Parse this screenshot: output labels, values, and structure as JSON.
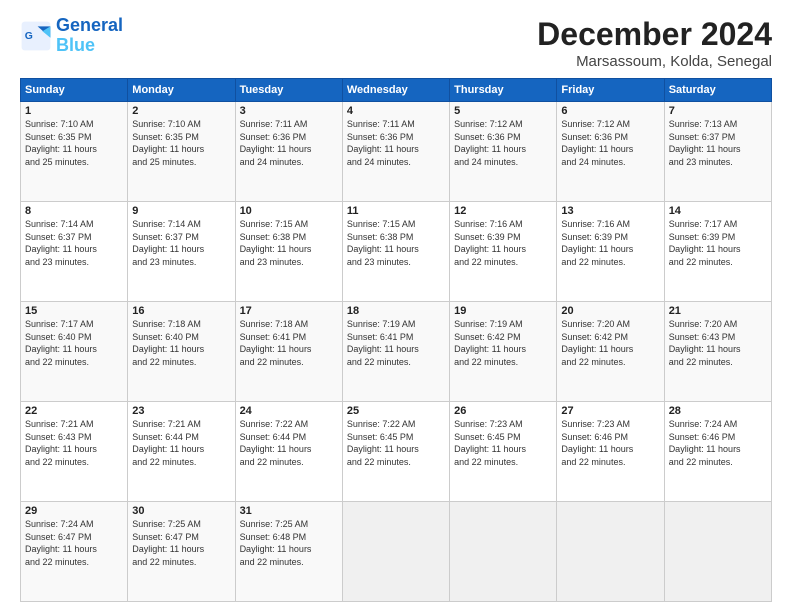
{
  "logo": {
    "line1": "General",
    "line2": "Blue"
  },
  "title": "December 2024",
  "subtitle": "Marsassoum, Kolda, Senegal",
  "days_of_week": [
    "Sunday",
    "Monday",
    "Tuesday",
    "Wednesday",
    "Thursday",
    "Friday",
    "Saturday"
  ],
  "weeks": [
    [
      {
        "day": "1",
        "info": "Sunrise: 7:10 AM\nSunset: 6:35 PM\nDaylight: 11 hours\nand 25 minutes."
      },
      {
        "day": "2",
        "info": "Sunrise: 7:10 AM\nSunset: 6:35 PM\nDaylight: 11 hours\nand 25 minutes."
      },
      {
        "day": "3",
        "info": "Sunrise: 7:11 AM\nSunset: 6:36 PM\nDaylight: 11 hours\nand 24 minutes."
      },
      {
        "day": "4",
        "info": "Sunrise: 7:11 AM\nSunset: 6:36 PM\nDaylight: 11 hours\nand 24 minutes."
      },
      {
        "day": "5",
        "info": "Sunrise: 7:12 AM\nSunset: 6:36 PM\nDaylight: 11 hours\nand 24 minutes."
      },
      {
        "day": "6",
        "info": "Sunrise: 7:12 AM\nSunset: 6:36 PM\nDaylight: 11 hours\nand 24 minutes."
      },
      {
        "day": "7",
        "info": "Sunrise: 7:13 AM\nSunset: 6:37 PM\nDaylight: 11 hours\nand 23 minutes."
      }
    ],
    [
      {
        "day": "8",
        "info": "Sunrise: 7:14 AM\nSunset: 6:37 PM\nDaylight: 11 hours\nand 23 minutes."
      },
      {
        "day": "9",
        "info": "Sunrise: 7:14 AM\nSunset: 6:37 PM\nDaylight: 11 hours\nand 23 minutes."
      },
      {
        "day": "10",
        "info": "Sunrise: 7:15 AM\nSunset: 6:38 PM\nDaylight: 11 hours\nand 23 minutes."
      },
      {
        "day": "11",
        "info": "Sunrise: 7:15 AM\nSunset: 6:38 PM\nDaylight: 11 hours\nand 23 minutes."
      },
      {
        "day": "12",
        "info": "Sunrise: 7:16 AM\nSunset: 6:39 PM\nDaylight: 11 hours\nand 22 minutes."
      },
      {
        "day": "13",
        "info": "Sunrise: 7:16 AM\nSunset: 6:39 PM\nDaylight: 11 hours\nand 22 minutes."
      },
      {
        "day": "14",
        "info": "Sunrise: 7:17 AM\nSunset: 6:39 PM\nDaylight: 11 hours\nand 22 minutes."
      }
    ],
    [
      {
        "day": "15",
        "info": "Sunrise: 7:17 AM\nSunset: 6:40 PM\nDaylight: 11 hours\nand 22 minutes."
      },
      {
        "day": "16",
        "info": "Sunrise: 7:18 AM\nSunset: 6:40 PM\nDaylight: 11 hours\nand 22 minutes."
      },
      {
        "day": "17",
        "info": "Sunrise: 7:18 AM\nSunset: 6:41 PM\nDaylight: 11 hours\nand 22 minutes."
      },
      {
        "day": "18",
        "info": "Sunrise: 7:19 AM\nSunset: 6:41 PM\nDaylight: 11 hours\nand 22 minutes."
      },
      {
        "day": "19",
        "info": "Sunrise: 7:19 AM\nSunset: 6:42 PM\nDaylight: 11 hours\nand 22 minutes."
      },
      {
        "day": "20",
        "info": "Sunrise: 7:20 AM\nSunset: 6:42 PM\nDaylight: 11 hours\nand 22 minutes."
      },
      {
        "day": "21",
        "info": "Sunrise: 7:20 AM\nSunset: 6:43 PM\nDaylight: 11 hours\nand 22 minutes."
      }
    ],
    [
      {
        "day": "22",
        "info": "Sunrise: 7:21 AM\nSunset: 6:43 PM\nDaylight: 11 hours\nand 22 minutes."
      },
      {
        "day": "23",
        "info": "Sunrise: 7:21 AM\nSunset: 6:44 PM\nDaylight: 11 hours\nand 22 minutes."
      },
      {
        "day": "24",
        "info": "Sunrise: 7:22 AM\nSunset: 6:44 PM\nDaylight: 11 hours\nand 22 minutes."
      },
      {
        "day": "25",
        "info": "Sunrise: 7:22 AM\nSunset: 6:45 PM\nDaylight: 11 hours\nand 22 minutes."
      },
      {
        "day": "26",
        "info": "Sunrise: 7:23 AM\nSunset: 6:45 PM\nDaylight: 11 hours\nand 22 minutes."
      },
      {
        "day": "27",
        "info": "Sunrise: 7:23 AM\nSunset: 6:46 PM\nDaylight: 11 hours\nand 22 minutes."
      },
      {
        "day": "28",
        "info": "Sunrise: 7:24 AM\nSunset: 6:46 PM\nDaylight: 11 hours\nand 22 minutes."
      }
    ],
    [
      {
        "day": "29",
        "info": "Sunrise: 7:24 AM\nSunset: 6:47 PM\nDaylight: 11 hours\nand 22 minutes."
      },
      {
        "day": "30",
        "info": "Sunrise: 7:25 AM\nSunset: 6:47 PM\nDaylight: 11 hours\nand 22 minutes."
      },
      {
        "day": "31",
        "info": "Sunrise: 7:25 AM\nSunset: 6:48 PM\nDaylight: 11 hours\nand 22 minutes."
      },
      {
        "day": "",
        "info": ""
      },
      {
        "day": "",
        "info": ""
      },
      {
        "day": "",
        "info": ""
      },
      {
        "day": "",
        "info": ""
      }
    ]
  ]
}
